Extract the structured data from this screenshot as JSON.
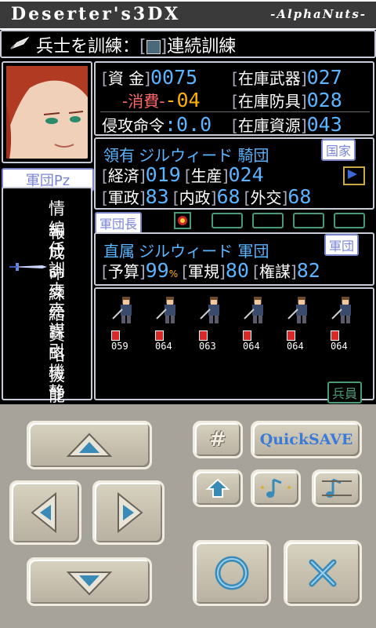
{
  "header": {
    "title": "Deserter's3DX",
    "right_title": "-AlphaNuts-"
  },
  "command": {
    "text": "兵士を訓練：",
    "mode": "連続訓練"
  },
  "resources": {
    "funds_label": "資 金",
    "funds_value": "0075",
    "consume_label": "-消費-",
    "consume_value": "-04",
    "weapons_label": "在庫武器",
    "weapons_value": "027",
    "armor_label": "在庫防具",
    "armor_value": "028",
    "invade_label": "侵攻命令",
    "invade_value": ":0.0",
    "material_label": "在庫資源",
    "material_value": "043"
  },
  "nation": {
    "owner_label": "領有",
    "owner_name": "ジルウィード 騎団",
    "tag": "国家",
    "economy_label": "経済",
    "economy_value": "019",
    "production_label": "生産",
    "production_value": "024",
    "military_label": "軍政",
    "military_value": "83",
    "internal_label": "内政",
    "internal_value": "68",
    "diplomacy_label": "外交",
    "diplomacy_value": "68"
  },
  "leader_row": {
    "label": "軍団長"
  },
  "corps": {
    "direct_label": "直属",
    "direct_name": "ジルウィード 軍団",
    "tag": "軍団",
    "budget_label": "予算",
    "budget_value": "99",
    "budget_unit": "%",
    "discipline_label": "軍規",
    "discipline_value": "80",
    "scheme_label": "権謀",
    "scheme_value": "82"
  },
  "side_tag": "軍団Pz",
  "menu": [
    "情報",
    "編成",
    "任命",
    "訓練",
    "支給",
    "売買",
    "謀略",
    "引抜",
    "機能",
    "静観"
  ],
  "selected_menu": "訓練",
  "soldiers": [
    "059",
    "064",
    "063",
    "064",
    "064",
    "064"
  ],
  "soldiers_tag": "兵員",
  "controls": {
    "hash_label": "#",
    "quicksave_label": "QuickSAVE"
  },
  "colors": {
    "value_blue": "#5ab4ff",
    "consume_orange": "#ffb000",
    "consume_red": "#ff6868",
    "tag_border": "#7a84c8"
  }
}
